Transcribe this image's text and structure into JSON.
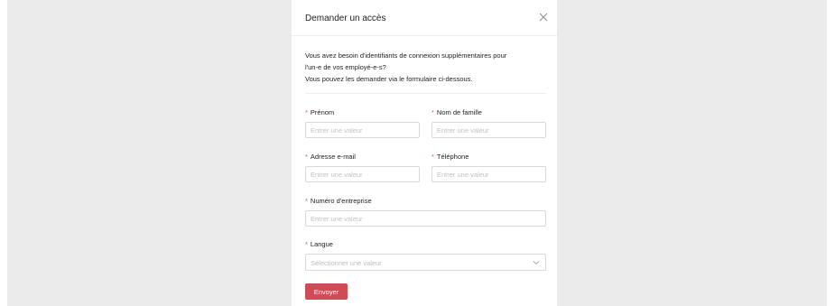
{
  "modal": {
    "title": "Demander un accès",
    "intro_lines": [
      "Vous avez besoin d'identifiants de connexion supplémentaires pour",
      "l'un-e de vos employé-e-s?",
      "Vous pouvez les demander via le formulaire ci-dessous."
    ]
  },
  "form": {
    "required_marker": "*",
    "fields": {
      "first_name": {
        "label": "Prénom",
        "placeholder": "Entrer une valeur",
        "value": ""
      },
      "last_name": {
        "label": "Nom de famille",
        "placeholder": "Entrer une valeur",
        "value": ""
      },
      "email": {
        "label": "Adresse e-mail",
        "placeholder": "Entrer une valeur",
        "value": ""
      },
      "phone": {
        "label": "Téléphone",
        "placeholder": "Entrer une valeur",
        "value": ""
      },
      "company_number": {
        "label": "Numéro d'entreprise",
        "placeholder": "Entrer une valeur",
        "value": ""
      },
      "language": {
        "label": "Langue",
        "placeholder": "Sélectionner une valeur"
      }
    },
    "submit_label": "Envoyer"
  },
  "colors": {
    "accent": "#cf4b55",
    "required": "#e0566a",
    "backdrop": "#ebebeb"
  },
  "icons": {
    "close": "close-icon",
    "select": "chevron-down-icon"
  }
}
